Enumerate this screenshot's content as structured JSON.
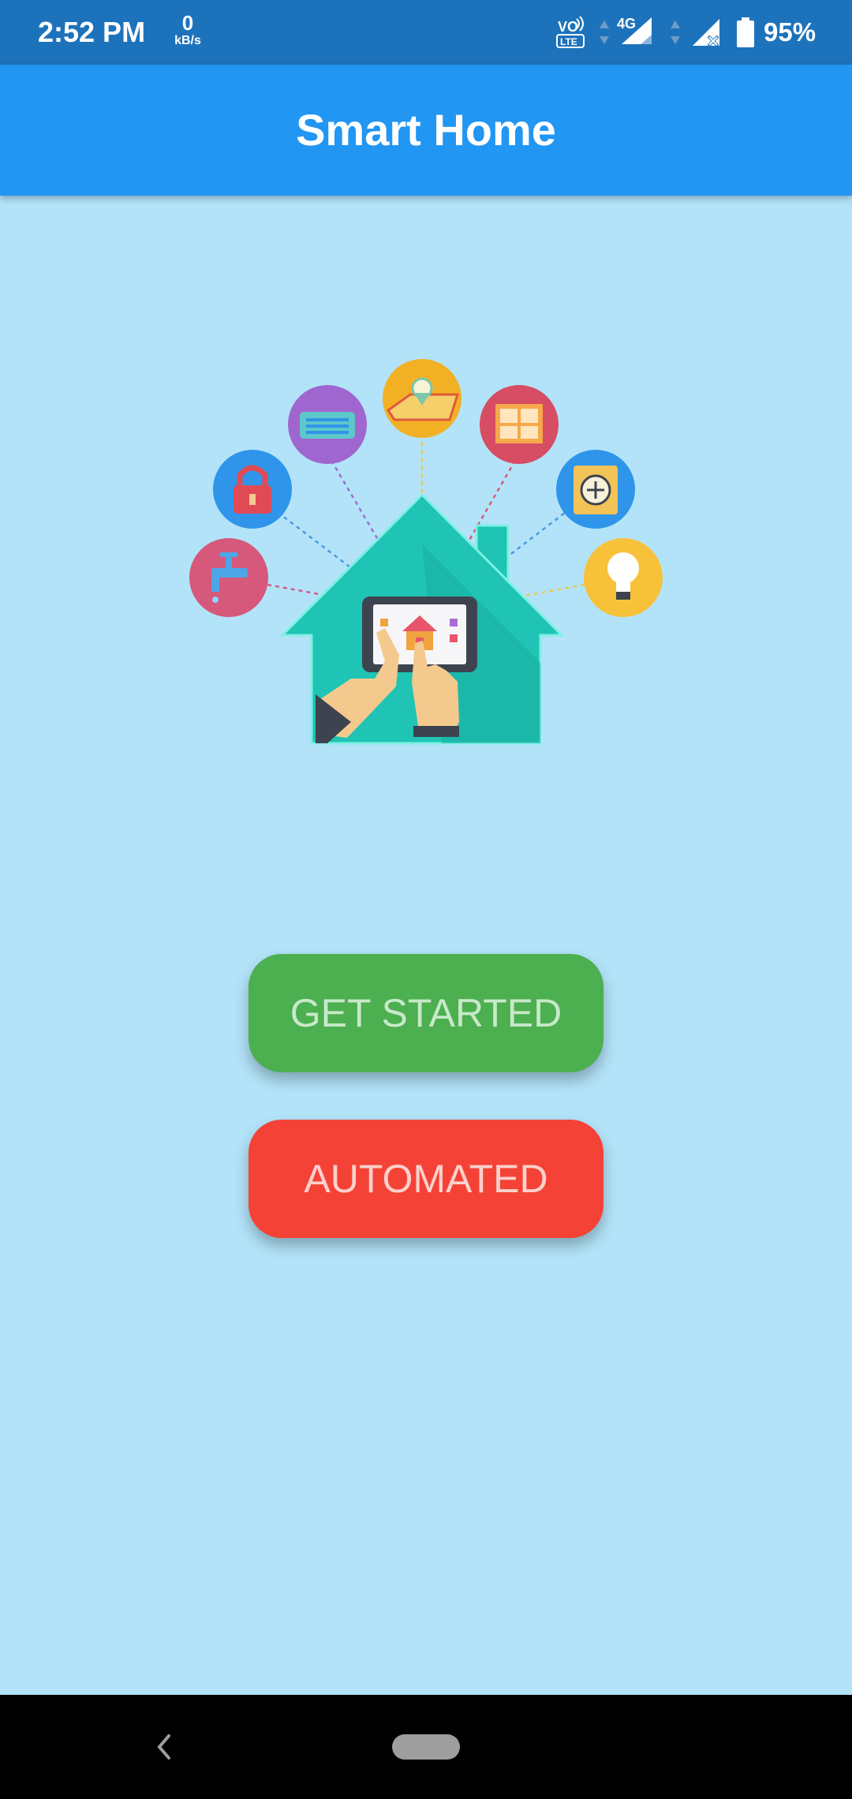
{
  "status_bar": {
    "time": "2:52 PM",
    "net_speed_value": "0",
    "net_speed_unit": "kB/s",
    "battery_percent": "95%",
    "icons": [
      "volte-icon",
      "data-arrows-icon",
      "signal-4g-icon",
      "data-arrows-icon",
      "signal-no-service-icon",
      "battery-icon"
    ]
  },
  "app_bar": {
    "title": "Smart Home"
  },
  "hero": {
    "icons": [
      "water-tap-icon",
      "padlock-icon",
      "air-conditioner-icon",
      "map-location-icon",
      "window-icon",
      "safe-icon",
      "light-bulb-icon",
      "house-icon",
      "tablet-icon"
    ]
  },
  "buttons": {
    "get_started": "GET STARTED",
    "automated": "AUTOMATED"
  },
  "nav_bar": {
    "icons": [
      "back-icon",
      "home-pill-icon"
    ]
  },
  "colors": {
    "status_bar": "#1d73bb",
    "app_bar": "#2196f3",
    "background": "#b3e3f9",
    "get_started": "#4caf50",
    "automated": "#f44336"
  }
}
